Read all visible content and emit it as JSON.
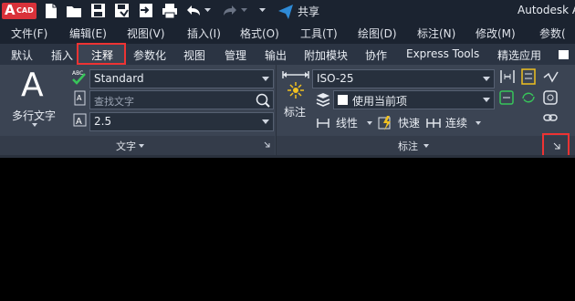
{
  "app": {
    "logo_text": "A",
    "logo_sub": "CAD",
    "title_fragment": "Autodesk A",
    "share_label": "共享",
    "accent_red": "#e03a3a",
    "accent_blue": "#2e8ad6"
  },
  "menu": {
    "items": [
      "文件(F)",
      "编辑(E)",
      "视图(V)",
      "插入(I)",
      "格式(O)",
      "工具(T)",
      "绘图(D)",
      "标注(N)",
      "修改(M)",
      "参数("
    ]
  },
  "tabs": [
    "默认",
    "插入",
    "注释",
    "参数化",
    "视图",
    "管理",
    "输出",
    "附加模块",
    "协作",
    "Express Tools",
    "精选应用"
  ],
  "text_panel": {
    "multiline_text_label": "多行文字",
    "style_value": "Standard",
    "find_placeholder": "查找文字",
    "height_value": "2.5",
    "panel_title": "文字",
    "abc_badge": "ABC"
  },
  "dimension_panel": {
    "dimension_button_label": "标注",
    "dim_style_value": "ISO-25",
    "layer_value": "使用当前项",
    "linear_label": "线性",
    "quick_label": "快速",
    "continue_label": "连续",
    "panel_title": "标注"
  }
}
